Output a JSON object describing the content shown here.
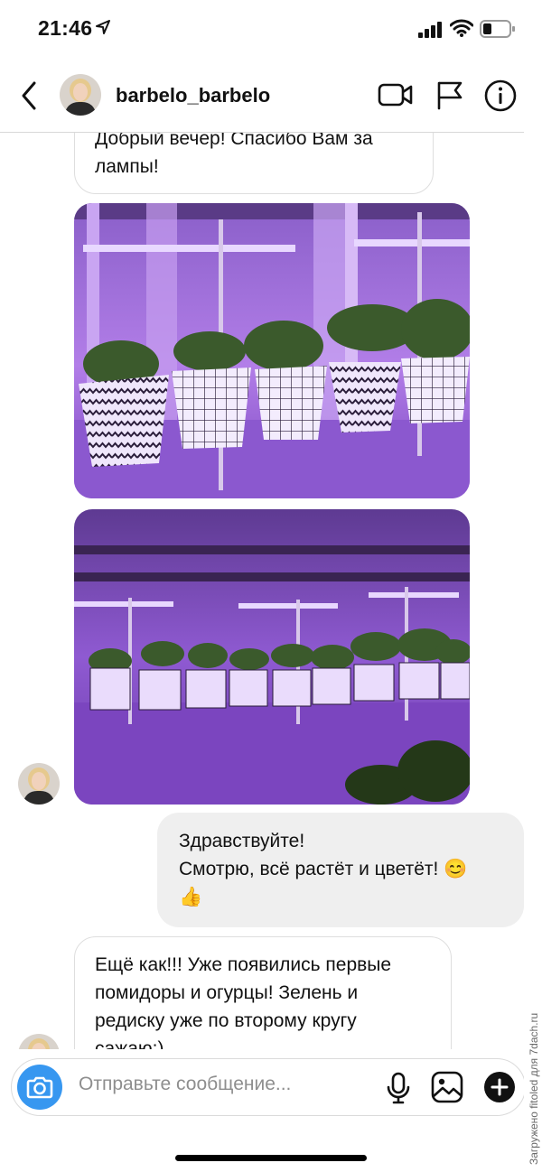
{
  "status_bar": {
    "time": "21:46"
  },
  "header": {
    "username": "barbelo_barbelo"
  },
  "messages": [
    {
      "type": "text",
      "from": "them",
      "text": "Добрый вечер! Спасибо Вам за\nлампы!"
    },
    {
      "type": "photo",
      "from": "them",
      "subject": "Seedlings in patterned pots under purple grow lamps on windowsill"
    },
    {
      "type": "photo",
      "from": "them",
      "subject": "Row of seedlings under three purple grow lamps"
    },
    {
      "type": "text",
      "from": "me",
      "text": "Здравствуйте!\nСмотрю, всё растёт и цветёт! 😊\n👍"
    },
    {
      "type": "text",
      "from": "them",
      "text": "Ещё как!!! Уже появились первые\nпомидоры и огурцы! Зелень и\nредиску уже по второму кругу\nсажаю:)"
    }
  ],
  "composer": {
    "placeholder": "Отправьте сообщение..."
  },
  "watermark": "Загружено fitoled для 7dach.ru",
  "colors": {
    "accent": "#3797f0",
    "grow_light": "#8a4fd0",
    "outgoing_bubble": "#efefef"
  }
}
